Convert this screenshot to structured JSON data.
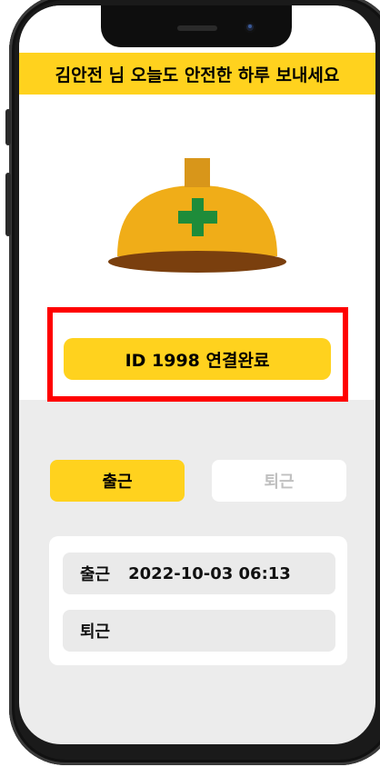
{
  "header": {
    "greeting": "김안전 님 오늘도 안전한 하루 보내세요"
  },
  "device": {
    "status": "ID 1998 연결완료"
  },
  "tabs": {
    "clock_in": "출근",
    "clock_out": "퇴근"
  },
  "records": [
    {
      "label": "출근",
      "value": "2022-10-03 06:13"
    },
    {
      "label": "퇴근",
      "value": ""
    }
  ],
  "colors": {
    "accent": "#ffd21e",
    "highlight_frame": "#ff0000",
    "helmet": "#f0ad18",
    "cross": "#1e8c3a"
  },
  "icons": {
    "helmet": "safety-helmet-icon"
  }
}
